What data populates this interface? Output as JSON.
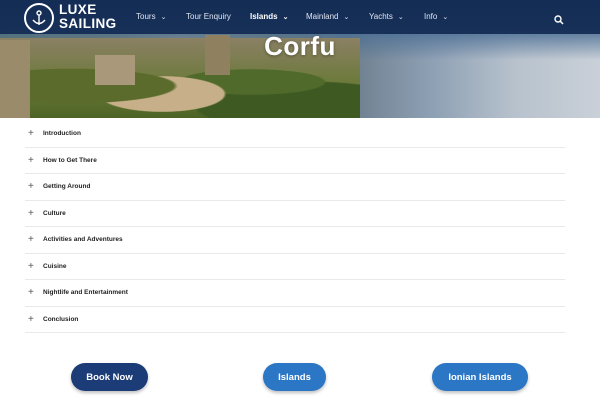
{
  "brand": {
    "line1": "LUXE",
    "line2": "SAILING"
  },
  "nav": {
    "items": [
      {
        "label": "Tours",
        "dropdown": true
      },
      {
        "label": "Tour Enquiry",
        "dropdown": false
      },
      {
        "label": "Islands",
        "dropdown": true,
        "active": true
      },
      {
        "label": "Mainland",
        "dropdown": true
      },
      {
        "label": "Yachts",
        "dropdown": true
      },
      {
        "label": "Info",
        "dropdown": true
      }
    ],
    "search_icon": "search-icon",
    "chevron": "⌄"
  },
  "hero": {
    "title": "Corfu"
  },
  "accordion": {
    "items": [
      {
        "label": "Introduction"
      },
      {
        "label": "How to Get There"
      },
      {
        "label": "Getting Around"
      },
      {
        "label": "Culture"
      },
      {
        "label": "Activities and Adventures"
      },
      {
        "label": "Cuisine"
      },
      {
        "label": "Nightlife and Entertainment"
      },
      {
        "label": "Conclusion"
      }
    ],
    "toggle_symbol": "+"
  },
  "buttons": {
    "book_now": "Book Now",
    "islands": "Islands",
    "ionian_islands": "Ionian Islands"
  },
  "colors": {
    "nav_bg": "#122a52",
    "primary_dark": "#1c3c78",
    "primary": "#2c76c6",
    "text": "#222222",
    "divider": "#e9e9e9"
  }
}
